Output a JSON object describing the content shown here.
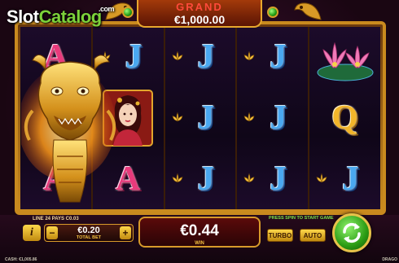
{
  "watermark": {
    "slot": "Slot",
    "catalog": "Catalog",
    "com": ".com"
  },
  "jackpot": {
    "label": "GRAND",
    "value": "€1,000.00"
  },
  "reels": [
    {
      "symbols": [
        "A",
        "",
        "A"
      ]
    },
    {
      "symbols": [
        "J",
        "woman",
        "A"
      ]
    },
    {
      "symbols": [
        "J",
        "J",
        "J"
      ]
    },
    {
      "symbols": [
        "J",
        "J",
        "J"
      ]
    },
    {
      "symbols": [
        "lotus",
        "Q",
        "J"
      ]
    }
  ],
  "footer": {
    "lines_info": "LINE 24 PAYS C0.03",
    "info_label": "i",
    "bet_minus": "−",
    "bet_plus": "+",
    "bet_value": "€0.20",
    "bet_label": "TOTAL BET",
    "win_value": "€0.44",
    "win_label": "WIN",
    "press_spin": "PRESS SPIN TO START GAME",
    "turbo_label": "TURBO",
    "auto_label": "AUTO",
    "cash_label": "CASH: €1,005.86",
    "game_name": "DRAGO"
  },
  "colors": {
    "frame_gold": "#c98a1e",
    "jackpot_red": "#ff4a3a",
    "spin_green": "#2b9c14",
    "letter_j": "#4aa8f0",
    "letter_a": "#e83a7c",
    "letter_q": "#f2b52a"
  },
  "icons": {
    "info": "info-icon",
    "minus": "minus-icon",
    "plus": "plus-icon",
    "spin": "refresh-arrows-icon",
    "wild": "golden-dragon-icon",
    "lotus": "lotus-flower-icon",
    "gem": "green-gem-icon"
  }
}
